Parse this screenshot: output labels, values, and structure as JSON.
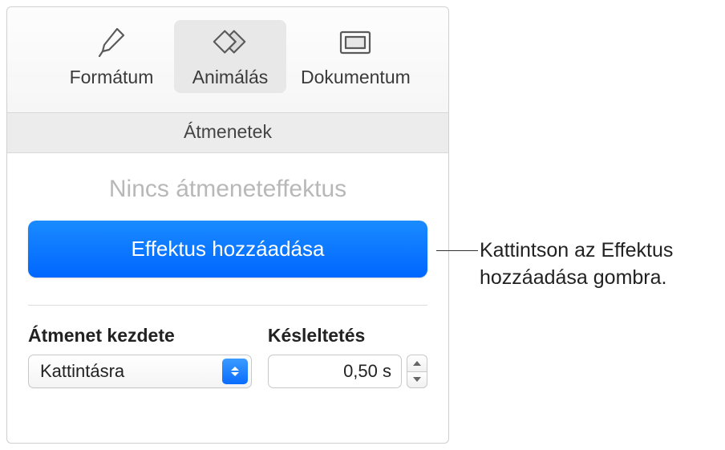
{
  "toolbar": {
    "format_label": "Formátum",
    "animate_label": "Animálás",
    "document_label": "Dokumentum"
  },
  "section": {
    "title": "Átmenetek"
  },
  "status": {
    "no_effect": "Nincs átmeneteffektus"
  },
  "buttons": {
    "add_effect": "Effektus hozzáadása"
  },
  "fields": {
    "start_label": "Átmenet kezdete",
    "start_value": "Kattintásra",
    "delay_label": "Késleltetés",
    "delay_value": "0,50 s"
  },
  "callout": {
    "line1": "Kattintson az Effektus",
    "line2": "hozzáadása gombra."
  }
}
